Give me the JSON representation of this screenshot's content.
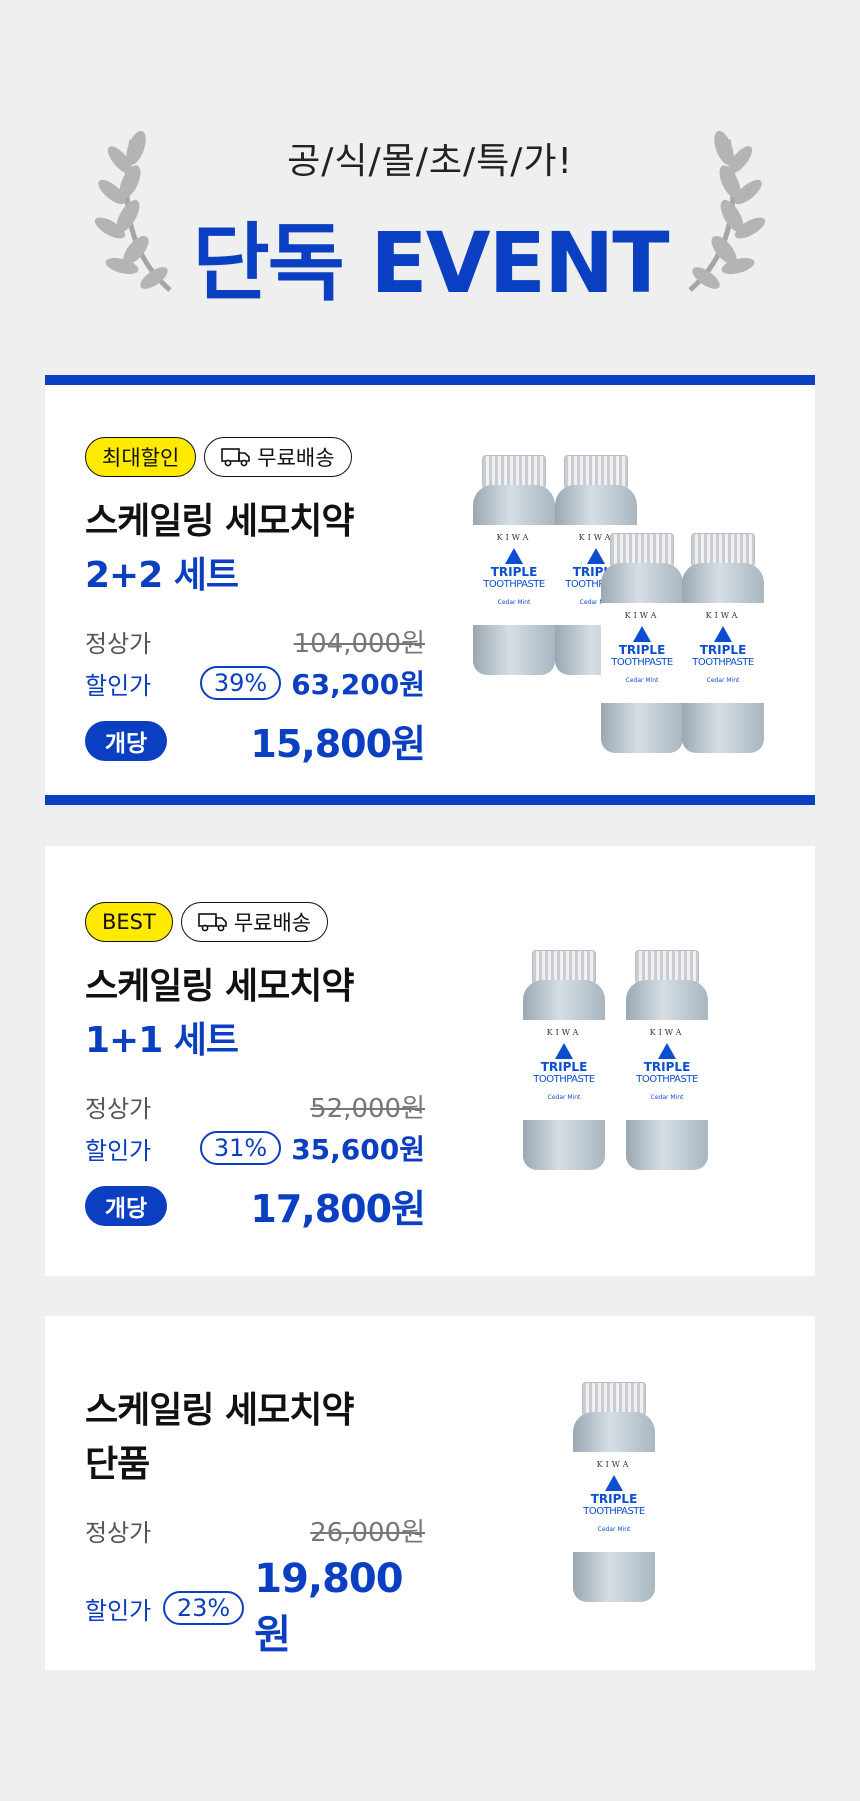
{
  "header": {
    "subtitle": "공/식/몰/초/특/가!",
    "title": "단독 EVENT"
  },
  "colors": {
    "brand_blue": "#0b3fc2",
    "tag_yellow": "#ffea00",
    "background": "#efefef"
  },
  "icons": {
    "laurel": "laurel-wreath-icon",
    "truck": "delivery-truck-icon"
  },
  "products": [
    {
      "badge": "최대할인",
      "shipping": "무료배송",
      "name": "스케일링 세모치약",
      "set": "2+2 세트",
      "regular_label": "정상가",
      "regular_price": "104,000원",
      "sale_label": "할인가",
      "discount": "39%",
      "sale_price": "63,200원",
      "unit_label": "개당",
      "unit_price": "15,800원"
    },
    {
      "badge": "BEST",
      "shipping": "무료배송",
      "name": "스케일링 세모치약",
      "set": "1+1 세트",
      "regular_label": "정상가",
      "regular_price": "52,000원",
      "sale_label": "할인가",
      "discount": "31%",
      "sale_price": "35,600원",
      "unit_label": "개당",
      "unit_price": "17,800원"
    },
    {
      "name": "스케일링 세모치약",
      "set": "단품",
      "regular_label": "정상가",
      "regular_price": "26,000원",
      "sale_label": "할인가",
      "discount": "23%",
      "sale_price": "19,800원"
    }
  ],
  "bottle_label": {
    "brand": "KIWA",
    "line1": "TRIPLE",
    "line2": "TOOTHPASTE",
    "flavor": "Cedar Mint"
  }
}
